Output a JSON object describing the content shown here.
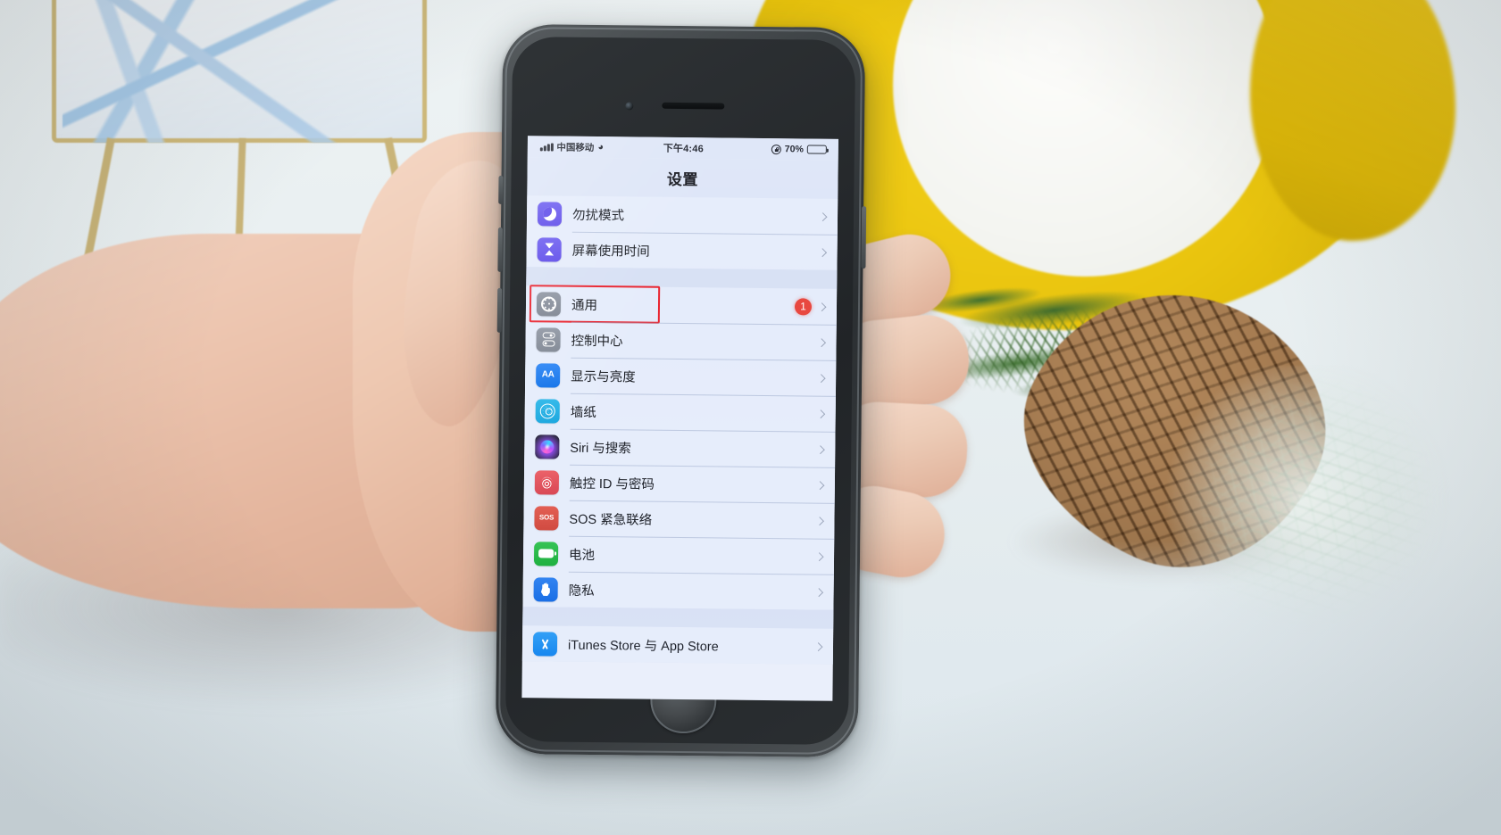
{
  "device": {
    "name": "iPhone",
    "scene_description": "hand-holding-iphone-photo"
  },
  "status_bar": {
    "signal_icon": "cellular-signal-icon",
    "carrier": "中国移动",
    "wifi_icon": "wifi-icon",
    "time": "下午4:46",
    "lock_icon": "rotation-lock-icon",
    "battery_percent": "70%",
    "battery_icon": "battery-icon",
    "battery_level": 70
  },
  "nav": {
    "title": "设置"
  },
  "highlight": {
    "color": "#e9202a",
    "target": "通用"
  },
  "groups": [
    {
      "id": "group-dnd",
      "rows": [
        {
          "label": "勿扰模式",
          "icon": "moon-icon",
          "icon_color": "#5a46e8",
          "badge": null,
          "chevron": true,
          "highlighted": false
        },
        {
          "label": "屏幕使用时间",
          "icon": "hourglass-icon",
          "icon_color": "#5a46e8",
          "badge": null,
          "chevron": true,
          "highlighted": false
        }
      ]
    },
    {
      "id": "group-system",
      "rows": [
        {
          "label": "通用",
          "icon": "gear-icon",
          "icon_color": "#7d8490",
          "badge": "1",
          "chevron": true,
          "highlighted": true
        },
        {
          "label": "控制中心",
          "icon": "control-center-icon",
          "icon_color": "#7d8490",
          "badge": null,
          "chevron": true,
          "highlighted": false
        },
        {
          "label": "显示与亮度",
          "icon": "display-aa-icon",
          "icon_color": "#0d6fe8",
          "badge": null,
          "chevron": true,
          "highlighted": false
        },
        {
          "label": "墙纸",
          "icon": "wallpaper-icon",
          "icon_color": "#12a3dd",
          "badge": null,
          "chevron": true,
          "highlighted": false
        },
        {
          "label": "Siri 与搜索",
          "icon": "siri-icon",
          "icon_color": "#7a3fd0",
          "badge": null,
          "chevron": true,
          "highlighted": false
        },
        {
          "label": "触控 ID 与密码",
          "icon": "touch-id-icon",
          "icon_color": "#d8414c",
          "badge": null,
          "chevron": true,
          "highlighted": false
        },
        {
          "label": "SOS 紧急联络",
          "icon": "sos-icon",
          "icon_color": "#cf4435",
          "badge": null,
          "chevron": true,
          "highlighted": false
        },
        {
          "label": "电池",
          "icon": "battery-settings-icon",
          "icon_color": "#16ad33",
          "badge": null,
          "chevron": true,
          "highlighted": false
        },
        {
          "label": "隐私",
          "icon": "privacy-hand-icon",
          "icon_color": "#1167e3",
          "badge": null,
          "chevron": true,
          "highlighted": false
        }
      ]
    },
    {
      "id": "group-stores",
      "rows": [
        {
          "label": "iTunes Store 与 App Store",
          "icon": "app-store-icon",
          "icon_color": "#0d80ee",
          "badge": null,
          "chevron": true,
          "highlighted": false
        }
      ]
    }
  ],
  "icon_glyphs": {
    "sos": "SOS",
    "aa": "AA"
  }
}
